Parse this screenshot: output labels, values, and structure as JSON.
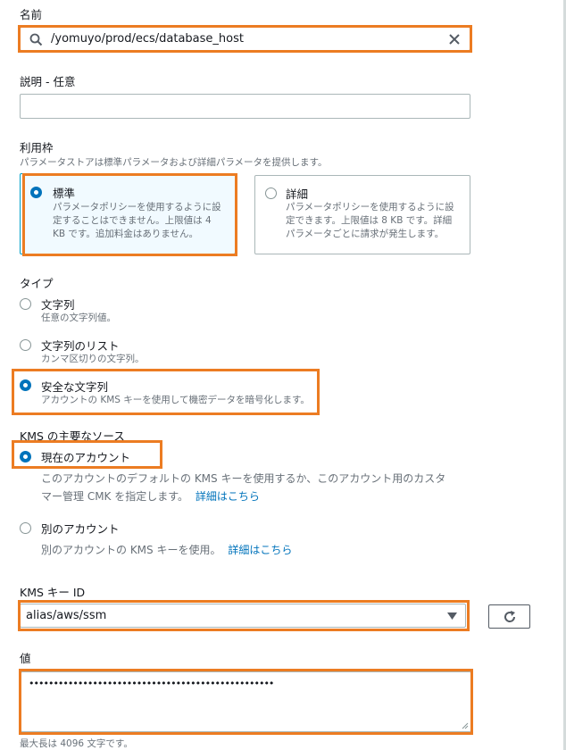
{
  "name_field": {
    "label": "名前",
    "value": "/yomuyo/prod/ecs/database_host"
  },
  "description_field": {
    "label": "説明 - 任意",
    "value": ""
  },
  "tier": {
    "label": "利用枠",
    "hint": "パラメータストアは標準パラメータおよび詳細パラメータを提供します。",
    "options": [
      {
        "title": "標準",
        "desc_1": "パラメータポリシーを使用するように設",
        "desc_2": "定することはできません。上限値は 4",
        "desc_3": "KB です。追加料金はありません。",
        "selected": true
      },
      {
        "title": "詳細",
        "desc_1": "パラメータポリシーを使用するように設",
        "desc_2": "定できます。上限値は 8 KB です。詳細",
        "desc_3": "パラメータごとに請求が発生します。",
        "selected": false
      }
    ]
  },
  "type": {
    "label": "タイプ",
    "options": [
      {
        "title": "文字列",
        "desc": "任意の文字列値。",
        "selected": false
      },
      {
        "title": "文字列のリスト",
        "desc": "カンマ区切りの文字列。",
        "selected": false
      },
      {
        "title": "安全な文字列",
        "desc": "アカウントの KMS キーを使用して機密データを暗号化します。",
        "selected": true
      }
    ]
  },
  "kms_source": {
    "label": "KMS の主要なソース",
    "options": [
      {
        "title": "現在のアカウント",
        "desc_1": "このアカウントのデフォルトの KMS キーを使用するか、このアカウント用のカスタ",
        "desc_2": "マー管理 CMK を指定します。",
        "link": "詳細はこちら",
        "selected": true
      },
      {
        "title": "別のアカウント",
        "desc": "別のアカウントの KMS キーを使用。",
        "link": "詳細はこちら",
        "selected": false
      }
    ]
  },
  "kms_key": {
    "label": "KMS キー ID",
    "value": "alias/aws/ssm"
  },
  "value_field": {
    "label": "値",
    "masked": "••••••••••••••••••••••••••••••••••••••••••••••••••",
    "hint": "最大長は 4096 文字です。"
  },
  "colors": {
    "highlight": "#ec7c22",
    "accent": "#0073bb"
  }
}
